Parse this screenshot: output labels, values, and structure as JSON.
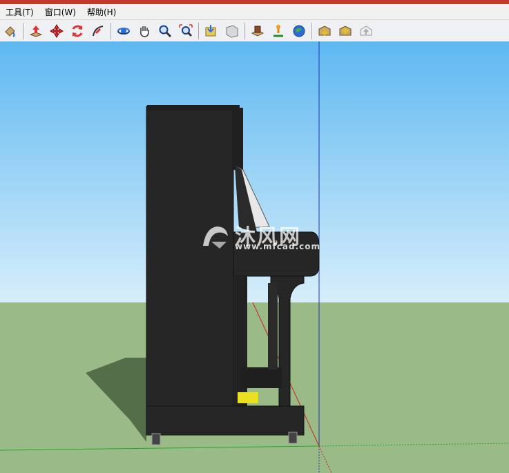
{
  "menubar": {
    "items": [
      {
        "label": "工具(T)"
      },
      {
        "label": "窗口(W)"
      },
      {
        "label": "帮助(H)"
      }
    ]
  },
  "toolbar": {
    "tools": [
      {
        "icon": "paint-bucket-icon"
      },
      {
        "icon": "push-pull-icon"
      },
      {
        "icon": "move-icon"
      },
      {
        "icon": "rotate-icon"
      },
      {
        "icon": "follow-me-icon"
      },
      {
        "icon": "orbit-icon"
      },
      {
        "icon": "pan-icon"
      },
      {
        "icon": "zoom-icon"
      },
      {
        "icon": "zoom-extents-icon"
      },
      {
        "icon": "get-models-icon"
      },
      {
        "icon": "share-model-icon"
      },
      {
        "icon": "components-icon"
      },
      {
        "icon": "add-location-icon"
      },
      {
        "icon": "google-earth-icon"
      },
      {
        "icon": "warehouse-download-icon"
      },
      {
        "icon": "warehouse-share-icon"
      },
      {
        "icon": "warehouse-upload-icon"
      }
    ]
  },
  "watermark": {
    "text_cn": "沐风网",
    "url": "www.mfcad.com"
  },
  "colors": {
    "sky_top": "#5eb8f1",
    "sky_bottom": "#d7eefb",
    "ground": "#9aba88",
    "model": "#262626",
    "red_axis": "#cc2222",
    "blue_axis": "#2233bb",
    "green_axis": "#22aa22"
  }
}
